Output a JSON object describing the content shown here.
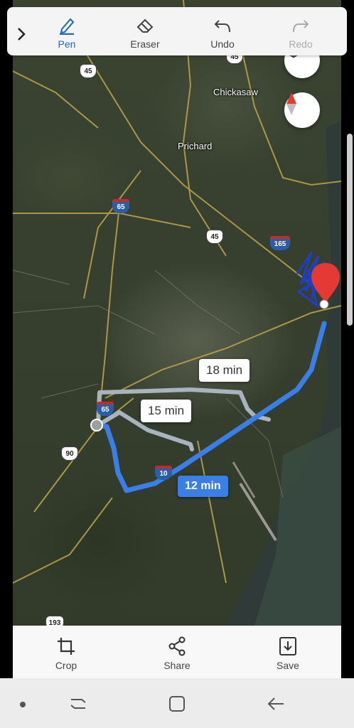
{
  "toolbar": {
    "expand_icon": "chevron-right-icon",
    "pen_label": "Pen",
    "eraser_label": "Eraser",
    "undo_label": "Undo",
    "redo_label": "Redo"
  },
  "map": {
    "place_labels": {
      "chickasaw": "Chickasaw",
      "prichard": "Prichard"
    },
    "route_shields": {
      "us45_top": "45",
      "us45_mid": "45",
      "i65_top": "65",
      "i165": "165",
      "i65_mid": "65",
      "us90": "90",
      "i10": "10",
      "us193": "193"
    },
    "routes": {
      "selected_time": "12 min",
      "alt1_time": "18 min",
      "alt2_time": "15 min"
    },
    "colors": {
      "selected_route": "#3a7ee8",
      "alt_route": "#a9b3bd",
      "pen_ink": "#1f3fbf",
      "destination_pin": "#e53935"
    }
  },
  "bottom_actions": {
    "crop_label": "Crop",
    "share_label": "Share",
    "save_label": "Save"
  }
}
